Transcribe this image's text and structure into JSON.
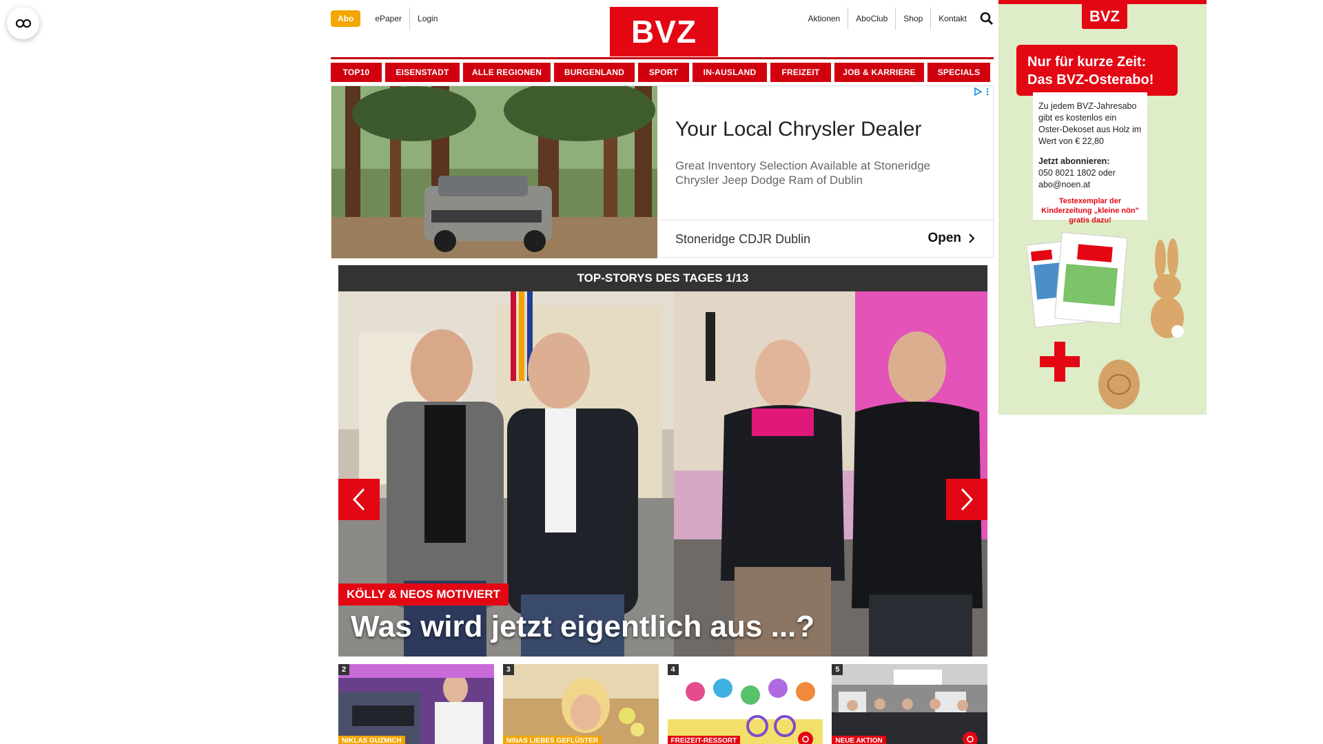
{
  "header": {
    "abo_label": "Abo",
    "epaper_label": "ePaper",
    "login_label": "Login",
    "logo_text": "BVZ",
    "right_links": [
      "Aktionen",
      "AboClub",
      "Shop",
      "Kontakt"
    ]
  },
  "nav": {
    "items": [
      "TOP10",
      "EISENSTADT",
      "ALLE REGIONEN",
      "BURGENLAND",
      "SPORT",
      "IN-AUSLAND",
      "FREIZEIT",
      "JOB & KARRIERE",
      "SPECIALS"
    ]
  },
  "ad": {
    "title": "Your Local Chrysler Dealer",
    "description": "Great Inventory Selection Available at Stoneridge Chrysler Jeep Dodge Ram of Dublin",
    "advertiser": "Stoneridge CDJR Dublin",
    "cta": "Open"
  },
  "stories": {
    "header": "TOP-STORYS DES TAGES 1/13",
    "tag": "KÖLLY & NEOS MOTIVIERT",
    "headline": "Was wird jetzt eigentlich aus ...?"
  },
  "thumbs": [
    {
      "num": "2",
      "tag": "NIKLAS GUZMICH"
    },
    {
      "num": "3",
      "tag": "NINAS LIEBES GEFLÜSTER"
    },
    {
      "num": "4",
      "tag": "FREIZEIT-RESSORT"
    },
    {
      "num": "5",
      "tag": "NEUE AKTION"
    }
  ],
  "side_ad": {
    "logo": "BVZ",
    "banner_line1": "Nur für kurze Zeit:",
    "banner_line2": "Das BVZ-Osterabo!",
    "body": "Zu jedem BVZ-Jahresabo gibt es kostenlos ein Oster-Dekoset aus Holz im Wert von € 22,80",
    "subscribe_label": "Jetzt abonnieren:",
    "contact": "050 8021 1802 oder abo@noen.at",
    "note": "Testexemplar der Kinderzeitung „kleine nön\" gratis dazu!"
  },
  "colors": {
    "brand_red": "#e30613",
    "abo_orange": "#f2a600",
    "dark_header": "#333333"
  }
}
